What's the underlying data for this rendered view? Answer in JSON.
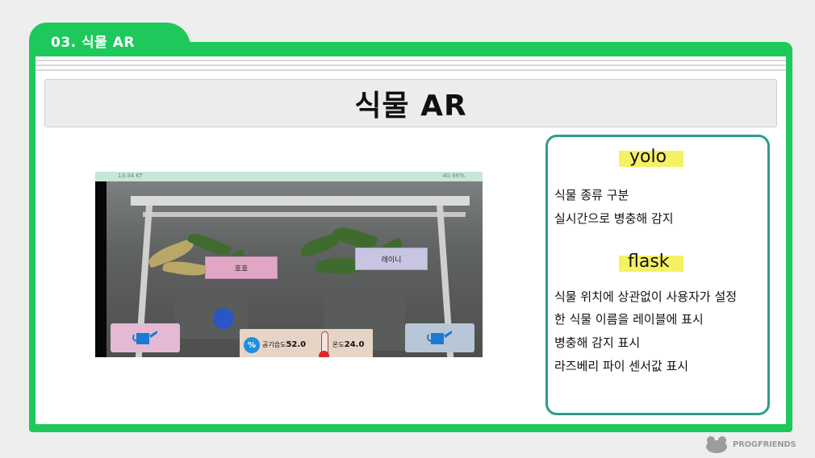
{
  "tab": {
    "label": "03. 식물 AR"
  },
  "title": "식물 AR",
  "screenshot": {
    "status_left": "13:34 KT",
    "status_right": "4G 66%",
    "label_left": "호호",
    "label_right": "레이니",
    "humidity_label": "공기습도",
    "humidity_value": "52.0",
    "temp_label": "온도",
    "temp_value": "24.0",
    "percent_symbol": "%"
  },
  "info": {
    "yolo": {
      "heading": "yolo",
      "lines": [
        "식물 종류 구분",
        "실시간으로 병충해 감지"
      ]
    },
    "flask": {
      "heading": "flask",
      "lines": [
        "식물 위치에 상관없이 사용자가 설정",
        "한 식물 이름을 레이블에 표시",
        "병충해 감지 표시",
        "라즈베리 파이 센서값 표시"
      ]
    }
  },
  "footer": {
    "brand": "PROGFRIENDS"
  },
  "colors": {
    "accent_green": "#1ec95c",
    "info_border": "#2e9d8a",
    "highlight": "#f4f263"
  }
}
